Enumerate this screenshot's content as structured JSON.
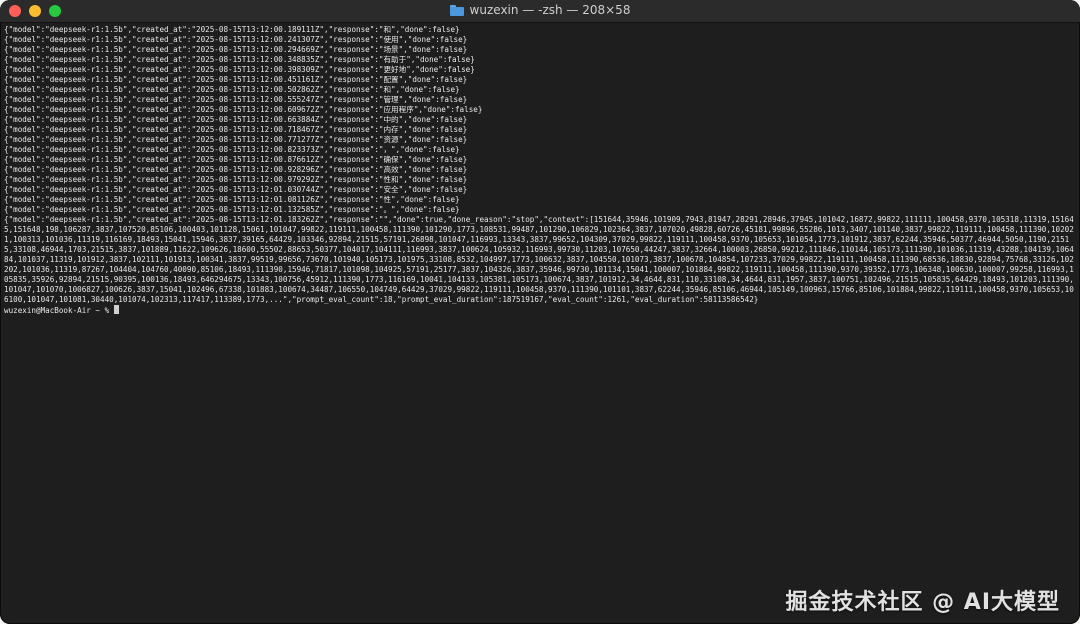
{
  "window": {
    "title": "wuzexin — -zsh — 208×58"
  },
  "terminal": {
    "lines": [
      "{\"model\":\"deepseek-r1:1.5b\",\"created_at\":\"2025-08-15T13:12:00.189111Z\",\"response\":\"和\",\"done\":false}",
      "{\"model\":\"deepseek-r1:1.5b\",\"created_at\":\"2025-08-15T13:12:00.241307Z\",\"response\":\"使用\",\"done\":false}",
      "{\"model\":\"deepseek-r1:1.5b\",\"created_at\":\"2025-08-15T13:12:00.294669Z\",\"response\":\"场景\",\"done\":false}",
      "{\"model\":\"deepseek-r1:1.5b\",\"created_at\":\"2025-08-15T13:12:00.348835Z\",\"response\":\"有助于\",\"done\":false}",
      "{\"model\":\"deepseek-r1:1.5b\",\"created_at\":\"2025-08-15T13:12:00.398309Z\",\"response\":\"更好地\",\"done\":false}",
      "{\"model\":\"deepseek-r1:1.5b\",\"created_at\":\"2025-08-15T13:12:00.451161Z\",\"response\":\"配置\",\"done\":false}",
      "{\"model\":\"deepseek-r1:1.5b\",\"created_at\":\"2025-08-15T13:12:00.502862Z\",\"response\":\"和\",\"done\":false}",
      "{\"model\":\"deepseek-r1:1.5b\",\"created_at\":\"2025-08-15T13:12:00.555247Z\",\"response\":\"管理\",\"done\":false}",
      "{\"model\":\"deepseek-r1:1.5b\",\"created_at\":\"2025-08-15T13:12:00.609672Z\",\"response\":\"应用程序\",\"done\":false}",
      "{\"model\":\"deepseek-r1:1.5b\",\"created_at\":\"2025-08-15T13:12:00.663884Z\",\"response\":\"中的\",\"done\":false}",
      "{\"model\":\"deepseek-r1:1.5b\",\"created_at\":\"2025-08-15T13:12:00.718467Z\",\"response\":\"内存\",\"done\":false}",
      "{\"model\":\"deepseek-r1:1.5b\",\"created_at\":\"2025-08-15T13:12:00.771277Z\",\"response\":\"资源\",\"done\":false}",
      "{\"model\":\"deepseek-r1:1.5b\",\"created_at\":\"2025-08-15T13:12:00.823373Z\",\"response\":\"，\",\"done\":false}",
      "{\"model\":\"deepseek-r1:1.5b\",\"created_at\":\"2025-08-15T13:12:00.876612Z\",\"response\":\"确保\",\"done\":false}",
      "{\"model\":\"deepseek-r1:1.5b\",\"created_at\":\"2025-08-15T13:12:00.928296Z\",\"response\":\"高效\",\"done\":false}",
      "{\"model\":\"deepseek-r1:1.5b\",\"created_at\":\"2025-08-15T13:12:00.979292Z\",\"response\":\"性和\",\"done\":false}",
      "{\"model\":\"deepseek-r1:1.5b\",\"created_at\":\"2025-08-15T13:12:01.030744Z\",\"response\":\"安全\",\"done\":false}",
      "{\"model\":\"deepseek-r1:1.5b\",\"created_at\":\"2025-08-15T13:12:01.081126Z\",\"response\":\"性\",\"done\":false}",
      "{\"model\":\"deepseek-r1:1.5b\",\"created_at\":\"2025-08-15T13:12:01.132585Z\",\"response\":\"。\",\"done\":false}"
    ],
    "final_response": "{\"model\":\"deepseek-r1:1.5b\",\"created_at\":\"2025-08-15T13:12:01.183262Z\",\"response\":\"\",\"done\":true,\"done_reason\":\"stop\",\"context\":[151644,35946,101909,7943,81947,28291,28946,37945,101042,16872,99822,111111,100458,9370,105318,11319,151645,151648,198,106287,3837,107520,85106,100403,101128,15061,101047,99822,119111,100458,111390,101290,1773,108531,99487,101290,106829,102364,3837,107020,49828,60726,45181,99896,55286,1013,3407,101140,3837,99822,119111,100458,111390,102021,100313,101036,11319,116169,18493,15041,15946,3837,39165,64429,103346,92894,21515,57191,26898,101047,116993,13343,3837,99652,104309,37029,99822,119111,100458,9370,105653,101054,1773,101912,3837,62244,35946,50377,46944,5050,1190,21515,33108,46944,1703,21515,3837,101889,11622,109626,18600,55502,88653,50377,104017,104111,116993,3837,100624,105932,116993,99730,11203,107650,44247,3837,32664,100003,26850,99212,111846,110144,105173,111390,101036,11319,43288,104139,106484,101037,11319,101912,3837,102111,101913,100341,3837,99519,99656,73670,101940,105173,101975,33108,8532,104997,1773,100632,3837,104550,101073,3837,100678,104854,107233,37029,99822,119111,100458,111390,68536,18830,92894,75768,33126,102202,101036,11319,87267,104404,104760,40090,85106,18493,111390,15946,71817,101098,104925,57191,25177,3837,104326,3837,35946,99730,101134,15041,100007,101884,99822,119111,100458,111390,9370,39352,1773,106348,100630,100007,99258,116993,105835,35926,92894,21515,90395,100136,18493,646294675,13343,100756,45912,111390,1773,116169,10041,104133,105381,105173,100674,3837,101912,34,4644,831,110,33108,34,4644,831,1957,3837,100751,102496,21515,105835,64429,18493,101203,111390,101047,101070,1006827,100626,3837,15041,102496,67338,101883,100674,34487,106550,104749,64429,37029,99822,119111,100458,9370,111390,101101,3837,62244,35946,85106,46944,105149,100963,15766,85106,101884,99822,119111,100458,9370,105653,106100,101047,101081,30440,101074,102313,117417,113389,1773,...\",\"prompt_eval_count\":18,\"prompt_eval_duration\":187519167,\"eval_count\":1261,\"eval_duration\":58113586542}",
    "prompt": "wuzexin@MacBook-Air ~ % "
  },
  "watermark": "掘金技术社区 @ AI大模型"
}
